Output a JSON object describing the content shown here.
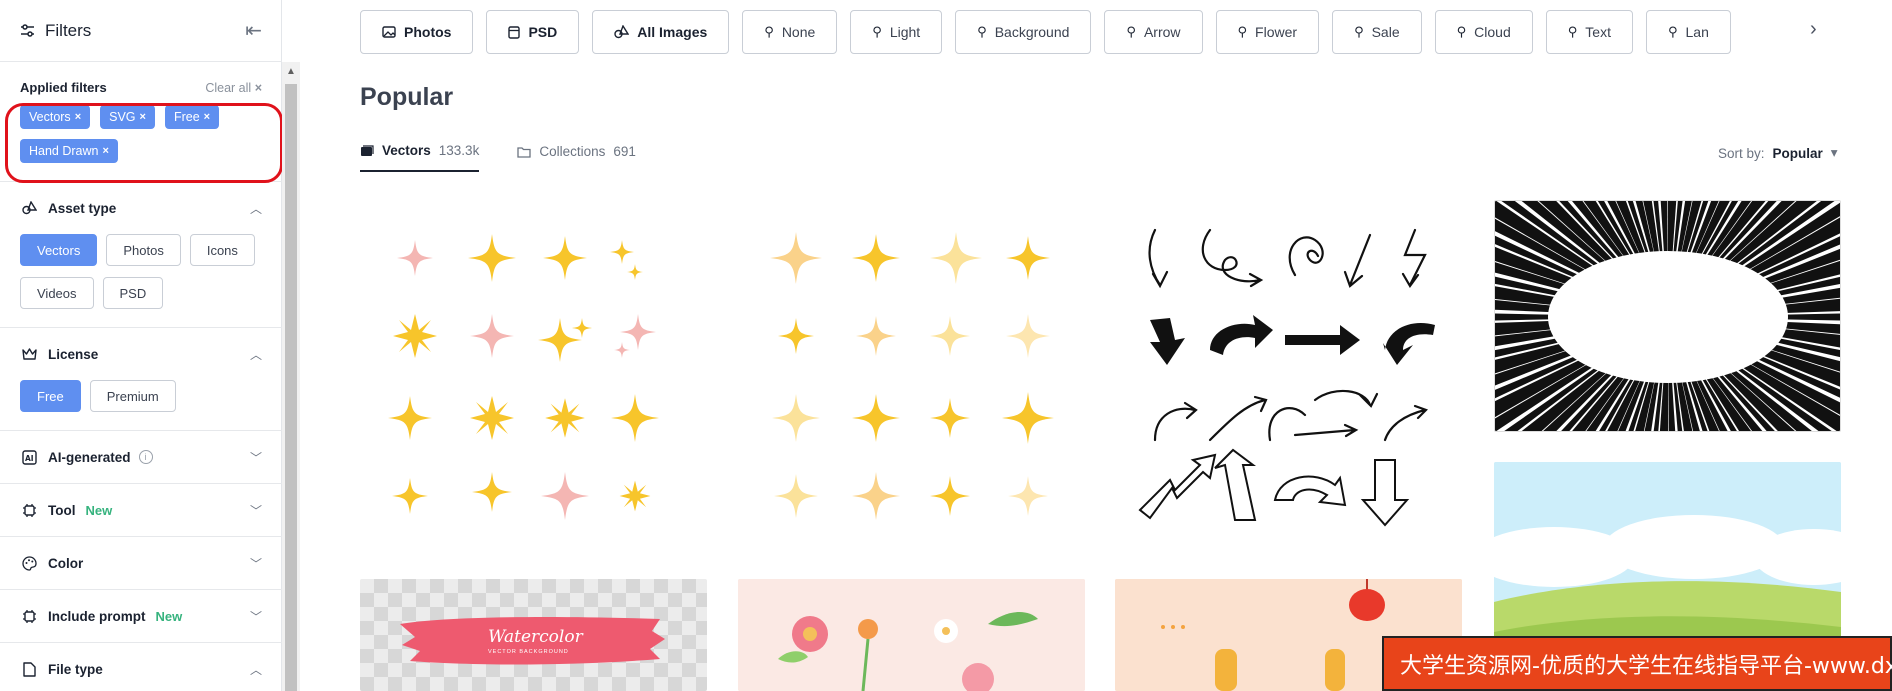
{
  "sidebar": {
    "title": "Filters",
    "applied": {
      "label": "Applied filters",
      "clear_all": "Clear all",
      "tags": [
        "Vectors",
        "SVG",
        "Free",
        "Hand Drawn"
      ]
    },
    "asset_type": {
      "label": "Asset type",
      "options": [
        "Vectors",
        "Photos",
        "Icons",
        "Videos",
        "PSD"
      ],
      "selected": "Vectors"
    },
    "license": {
      "label": "License",
      "options": [
        "Free",
        "Premium"
      ],
      "selected": "Free"
    },
    "ai_generated": {
      "label": "AI-generated"
    },
    "tool": {
      "label": "Tool",
      "badge": "New"
    },
    "color": {
      "label": "Color"
    },
    "include_prompt": {
      "label": "Include prompt",
      "badge": "New"
    },
    "file_type": {
      "label": "File type"
    }
  },
  "topbar": {
    "items": [
      {
        "label": "Photos",
        "icon": "image-icon",
        "bold": true
      },
      {
        "label": "PSD",
        "icon": "file-icon",
        "bold": true
      },
      {
        "label": "All Images",
        "icon": "shapes-icon",
        "bold": true
      },
      {
        "label": "None",
        "icon": "search-icon"
      },
      {
        "label": "Light",
        "icon": "search-icon"
      },
      {
        "label": "Background",
        "icon": "search-icon"
      },
      {
        "label": "Arrow",
        "icon": "search-icon"
      },
      {
        "label": "Flower",
        "icon": "search-icon"
      },
      {
        "label": "Sale",
        "icon": "search-icon"
      },
      {
        "label": "Cloud",
        "icon": "search-icon"
      },
      {
        "label": "Text",
        "icon": "search-icon"
      },
      {
        "label": "Lan",
        "icon": "search-icon"
      }
    ]
  },
  "main": {
    "heading": "Popular",
    "tabs": [
      {
        "label": "Vectors",
        "count": "133.3k",
        "active": true
      },
      {
        "label": "Collections",
        "count": "691",
        "active": false
      }
    ],
    "sort": {
      "label": "Sort by:",
      "value": "Popular"
    },
    "thumb_text": {
      "watercolor_title": "Watercolor",
      "watercolor_sub": "VECTOR BACKGROUND"
    }
  },
  "watermark": "大学生资源网-优质的大学生在线指导平台-www.dxszyw.cn",
  "colors": {
    "accent": "#5f8ff0",
    "new_badge": "#36b37e",
    "highlight_ring": "#e0121b",
    "star_gold": "#f7c52b",
    "star_pink": "#f4b6b3"
  }
}
